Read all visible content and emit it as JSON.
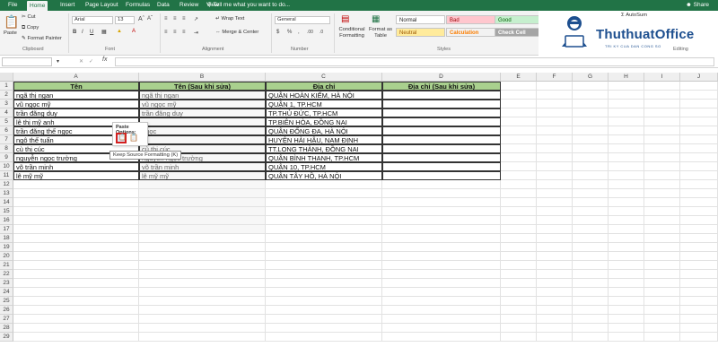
{
  "tabs": [
    "File",
    "Home",
    "Insert",
    "Page Layout",
    "Formulas",
    "Data",
    "Review",
    "View"
  ],
  "tell_me": "Tell me what you want to do...",
  "share": "Share",
  "ribbon": {
    "clipboard": {
      "paste": "Paste",
      "cut": "Cut",
      "copy": "Copy",
      "format_painter": "Format Painter",
      "label": "Clipboard"
    },
    "font": {
      "name": "Arial",
      "size": "13",
      "label": "Font"
    },
    "alignment": {
      "wrap_text": "Wrap Text",
      "merge_center": "Merge & Center",
      "label": "Alignment"
    },
    "number": {
      "format": "General",
      "label": "Number"
    },
    "styles": {
      "conditional": "Conditional Formatting",
      "format_table": "Format as Table",
      "normal": "Normal",
      "bad": "Bad",
      "good": "Good",
      "neutral": "Neutral",
      "calculation": "Calculation",
      "check_cell": "Check Cell",
      "label": "Styles"
    },
    "editing": {
      "autosum": "AutoSum",
      "fill": "Fill",
      "clear": "Clear",
      "label": "Editing"
    }
  },
  "logo": {
    "text": "ThuthuatOffice",
    "tagline": "TRI KY CUA DAN CONG SO"
  },
  "formula_bar": {
    "fx": "fx",
    "value": ""
  },
  "columns": [
    "A",
    "B",
    "C",
    "D",
    "E",
    "F",
    "G",
    "H",
    "I",
    "J"
  ],
  "rows": [
    "1",
    "2",
    "3",
    "4",
    "5",
    "6",
    "7",
    "8",
    "9",
    "10",
    "11",
    "12",
    "13",
    "14",
    "15",
    "16",
    "17",
    "18",
    "19",
    "20",
    "21",
    "22",
    "23",
    "24",
    "25",
    "26",
    "27",
    "28",
    "29"
  ],
  "headers": {
    "a": "Tên",
    "b": "Tên (Sau khi sửa)",
    "c": "Địa chỉ",
    "d": "Địa chỉ (Sau khi sửa)"
  },
  "data": [
    {
      "a": "ngã thị ngan",
      "b": "ngã thị ngan",
      "c": "QUẬN HOÀN KIẾM, HÀ NỘI"
    },
    {
      "a": "vũ ngọc mỹ",
      "b": "vũ ngọc mỹ",
      "c": "QUẬN 1, TP.HCM"
    },
    {
      "a": "trần đăng duy",
      "b": "trần đăng duy",
      "c": "TP.THỦ ĐỨC, TP.HCM"
    },
    {
      "a": "lê thị mỹ anh",
      "b": "",
      "c": "TP.BIÊN HÒA, ĐỒNG NAI"
    },
    {
      "a": "trần đăng thế ngọc",
      "b": "ngọc",
      "c": "QUẬN ĐỐNG ĐA, HÀ NỘI"
    },
    {
      "a": "ngô thế tuấn",
      "b": "",
      "c": "HUYỆN HẢI HẬU, NAM ĐỊNH"
    },
    {
      "a": "cù thị cúc",
      "b": "cù thị cúc",
      "c": "TT.LONG THÀNH, ĐỒNG NAI"
    },
    {
      "a": "nguyễn ngọc trường",
      "b": "nguyễn ngọc trường",
      "c": "QUẬN BÌNH THẠNH, TP.HCM"
    },
    {
      "a": "võ trần minh",
      "b": "võ trần minh",
      "c": "QUẬN 10, TP.HCM"
    },
    {
      "a": "lê mỹ mỹ",
      "b": "lê mỹ mỹ",
      "c": "QUẬN TÂY HỒ, HÀ NỘI"
    }
  ],
  "paste_options": {
    "title": "Paste Options:",
    "tooltip": "Keep Source Formatting (K)"
  },
  "colors": {
    "excel_green": "#217346",
    "header_green": "#a9d08e",
    "bad_bg": "#ffc7ce",
    "good_bg": "#c6efce",
    "neutral_bg": "#ffeb9c",
    "calc_bg": "#f2f2f2",
    "check_bg": "#a5a5a5"
  }
}
